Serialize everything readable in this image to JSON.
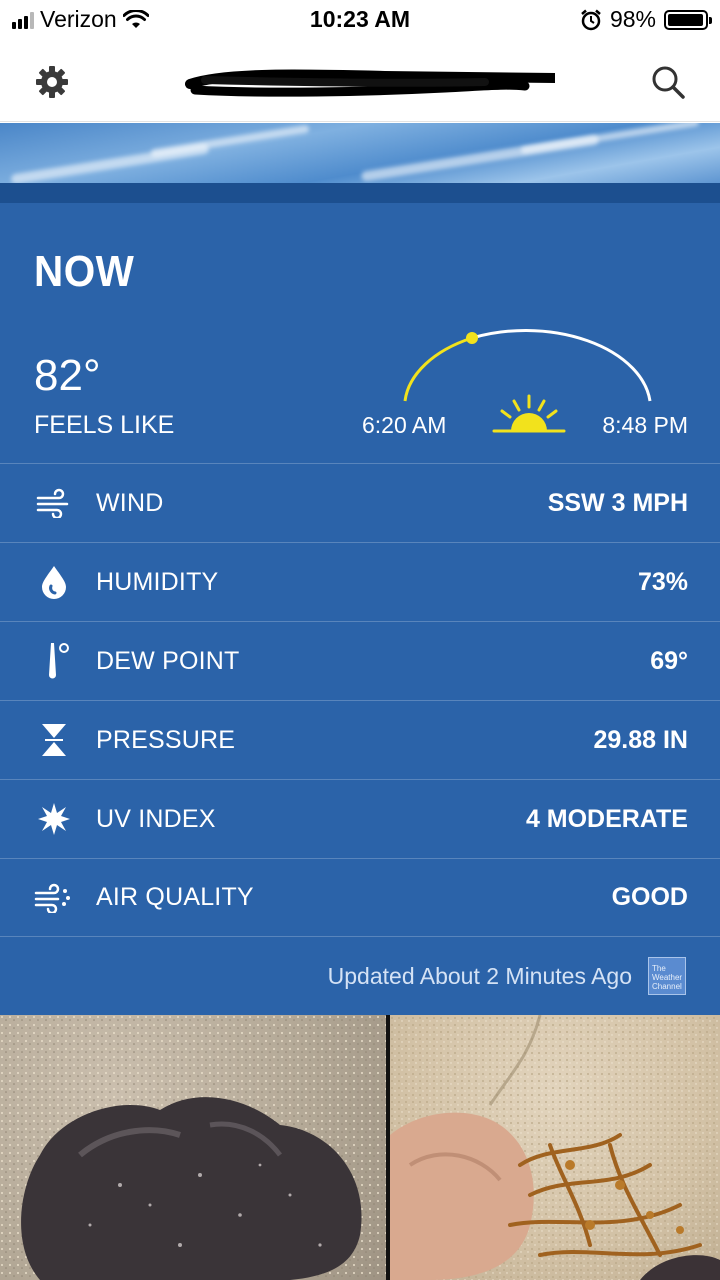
{
  "status_bar": {
    "carrier": "Verizon",
    "time": "10:23 AM",
    "battery_pct": "98%",
    "battery_level": 0.98,
    "icons": [
      "signal-icon",
      "wifi-icon",
      "alarm-icon",
      "battery-icon"
    ]
  },
  "nav": {
    "icons": [
      "gear-icon",
      "search-icon"
    ]
  },
  "current": {
    "section_title": "NOW",
    "temperature": "82°",
    "feels_like_label": "FEELS LIKE",
    "sunrise": "6:20 AM",
    "sunset": "8:48 PM"
  },
  "rows": [
    {
      "label": "WIND",
      "value": "SSW 3 MPH",
      "icon": "wind-icon"
    },
    {
      "label": "HUMIDITY",
      "value": "73%",
      "icon": "humidity-drop-icon"
    },
    {
      "label": "DEW POINT",
      "value": "69°",
      "icon": "dew-point-icon"
    },
    {
      "label": "PRESSURE",
      "value": "29.88 IN",
      "icon": "pressure-icon"
    },
    {
      "label": "UV INDEX",
      "value": "4 MODERATE",
      "icon": "uv-sun-icon"
    },
    {
      "label": "AIR QUALITY",
      "value": "GOOD",
      "icon": "air-quality-icon"
    }
  ],
  "footer": {
    "updated": "Updated About 2 Minutes Ago",
    "logo_text": "The Weather Channel"
  },
  "colors": {
    "card_background": "#2b63a9",
    "sun_yellow": "#f2e21c",
    "arc_white": "#ffffff"
  }
}
